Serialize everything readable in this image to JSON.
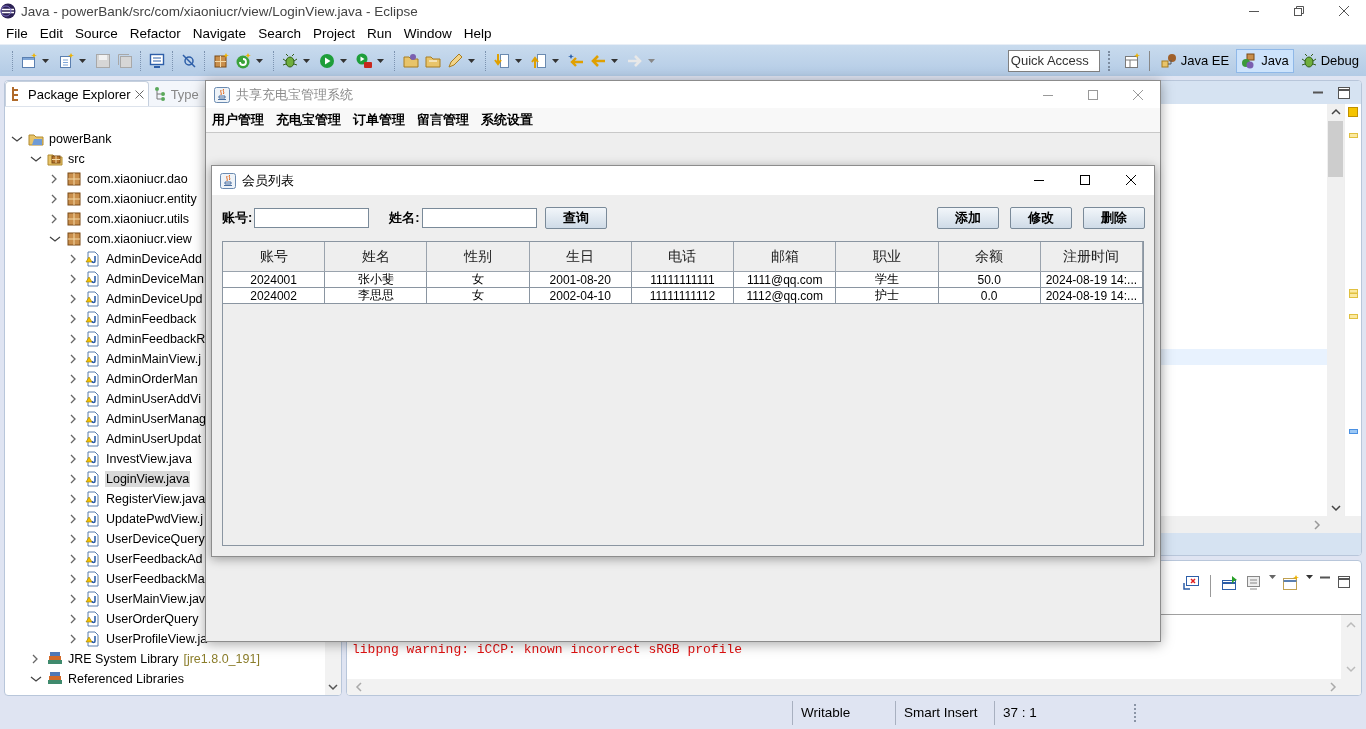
{
  "window": {
    "title": "Java - powerBank/src/com/xiaoniucr/view/LoginView.java - Eclipse"
  },
  "menu": [
    "File",
    "Edit",
    "Source",
    "Refactor",
    "Navigate",
    "Search",
    "Project",
    "Run",
    "Window",
    "Help"
  ],
  "toolbar": {
    "quick_access": {
      "placeholder": "Quick Access"
    },
    "perspectives": [
      {
        "label": "Java EE",
        "selected": false
      },
      {
        "label": "Java",
        "selected": true
      },
      {
        "label": "Debug",
        "selected": false
      }
    ]
  },
  "package_explorer": {
    "tabs": [
      {
        "label": "Package Explorer",
        "selected": true
      },
      {
        "label": "Type",
        "selected": false
      }
    ],
    "tree": [
      {
        "label": "powerBank",
        "kind": "project",
        "expanded": true,
        "selected": false,
        "children": [
          {
            "label": "src",
            "kind": "source",
            "expanded": true,
            "selected": false,
            "children": [
              {
                "label": "com.xiaoniucr.dao",
                "kind": "package",
                "expanded": false,
                "selected": false
              },
              {
                "label": "com.xiaoniucr.entity",
                "kind": "package",
                "expanded": false,
                "selected": false
              },
              {
                "label": "com.xiaoniucr.utils",
                "kind": "package",
                "expanded": false,
                "selected": false
              },
              {
                "label": "com.xiaoniucr.view",
                "kind": "package",
                "expanded": true,
                "selected": false,
                "children": [
                  {
                    "label": "AdminDeviceAdd",
                    "kind": "java",
                    "expanded": false,
                    "selected": false
                  },
                  {
                    "label": "AdminDeviceMan",
                    "kind": "java",
                    "expanded": false,
                    "selected": false
                  },
                  {
                    "label": "AdminDeviceUpd",
                    "kind": "java",
                    "expanded": false,
                    "selected": false
                  },
                  {
                    "label": "AdminFeedback",
                    "kind": "java",
                    "expanded": false,
                    "selected": false
                  },
                  {
                    "label": "AdminFeedbackR",
                    "kind": "java",
                    "expanded": false,
                    "selected": false
                  },
                  {
                    "label": "AdminMainView.j",
                    "kind": "java",
                    "expanded": false,
                    "selected": false
                  },
                  {
                    "label": "AdminOrderMan",
                    "kind": "java",
                    "expanded": false,
                    "selected": false
                  },
                  {
                    "label": "AdminUserAddVi",
                    "kind": "java",
                    "expanded": false,
                    "selected": false
                  },
                  {
                    "label": "AdminUserManag",
                    "kind": "java",
                    "expanded": false,
                    "selected": false
                  },
                  {
                    "label": "AdminUserUpdat",
                    "kind": "java",
                    "expanded": false,
                    "selected": false
                  },
                  {
                    "label": "InvestView.java",
                    "kind": "java",
                    "expanded": false,
                    "selected": false
                  },
                  {
                    "label": "LoginView.java",
                    "kind": "java",
                    "expanded": false,
                    "selected": true
                  },
                  {
                    "label": "RegisterView.java",
                    "kind": "java",
                    "expanded": false,
                    "selected": false
                  },
                  {
                    "label": "UpdatePwdView.j",
                    "kind": "java",
                    "expanded": false,
                    "selected": false
                  },
                  {
                    "label": "UserDeviceQuery",
                    "kind": "java",
                    "expanded": false,
                    "selected": false
                  },
                  {
                    "label": "UserFeedbackAd",
                    "kind": "java",
                    "expanded": false,
                    "selected": false
                  },
                  {
                    "label": "UserFeedbackMa",
                    "kind": "java",
                    "expanded": false,
                    "selected": false
                  },
                  {
                    "label": "UserMainView.jav",
                    "kind": "java",
                    "expanded": false,
                    "selected": false
                  },
                  {
                    "label": "UserOrderQuery",
                    "kind": "java",
                    "expanded": false,
                    "selected": false
                  },
                  {
                    "label": "UserProfileView.ja",
                    "kind": "java",
                    "expanded": false,
                    "selected": false
                  }
                ]
              }
            ]
          },
          {
            "label": "JRE System Library",
            "decoration": "[jre1.8.0_191]",
            "kind": "library",
            "expanded": false,
            "selected": false
          },
          {
            "label": "Referenced Libraries",
            "kind": "library",
            "expanded": true,
            "selected": false
          }
        ]
      }
    ]
  },
  "console": {
    "lines": [
      "libpng warning: iCCP: known incorrect sRGB profile"
    ]
  },
  "status_bar": [
    "Writable",
    "Smart Insert",
    "37 : 1"
  ],
  "swing_window": {
    "title": "共享充电宝管理系统",
    "menu": [
      "用户管理",
      "充电宝管理",
      "订单管理",
      "留言管理",
      "系统设置"
    ],
    "member_window": {
      "title": "会员列表",
      "search_fields": [
        {
          "label": "账号:"
        },
        {
          "label": "姓名:"
        }
      ],
      "search_button": "查询",
      "action_buttons": [
        "添加",
        "修改",
        "删除"
      ],
      "table": {
        "columns": [
          "账号",
          "姓名",
          "性别",
          "生日",
          "电话",
          "邮箱",
          "职业",
          "余额",
          "注册时间"
        ],
        "rows": [
          [
            "2024001",
            "张小斐",
            "女",
            "2001-08-20",
            "11111111111",
            "1111@qq.com",
            "学生",
            "50.0",
            "2024-08-19 14:..."
          ],
          [
            "2024002",
            "李思思",
            "女",
            "2002-04-10",
            "11111111112",
            "1112@qq.com",
            "护士",
            "0.0",
            "2024-08-19 14:..."
          ]
        ]
      }
    }
  }
}
